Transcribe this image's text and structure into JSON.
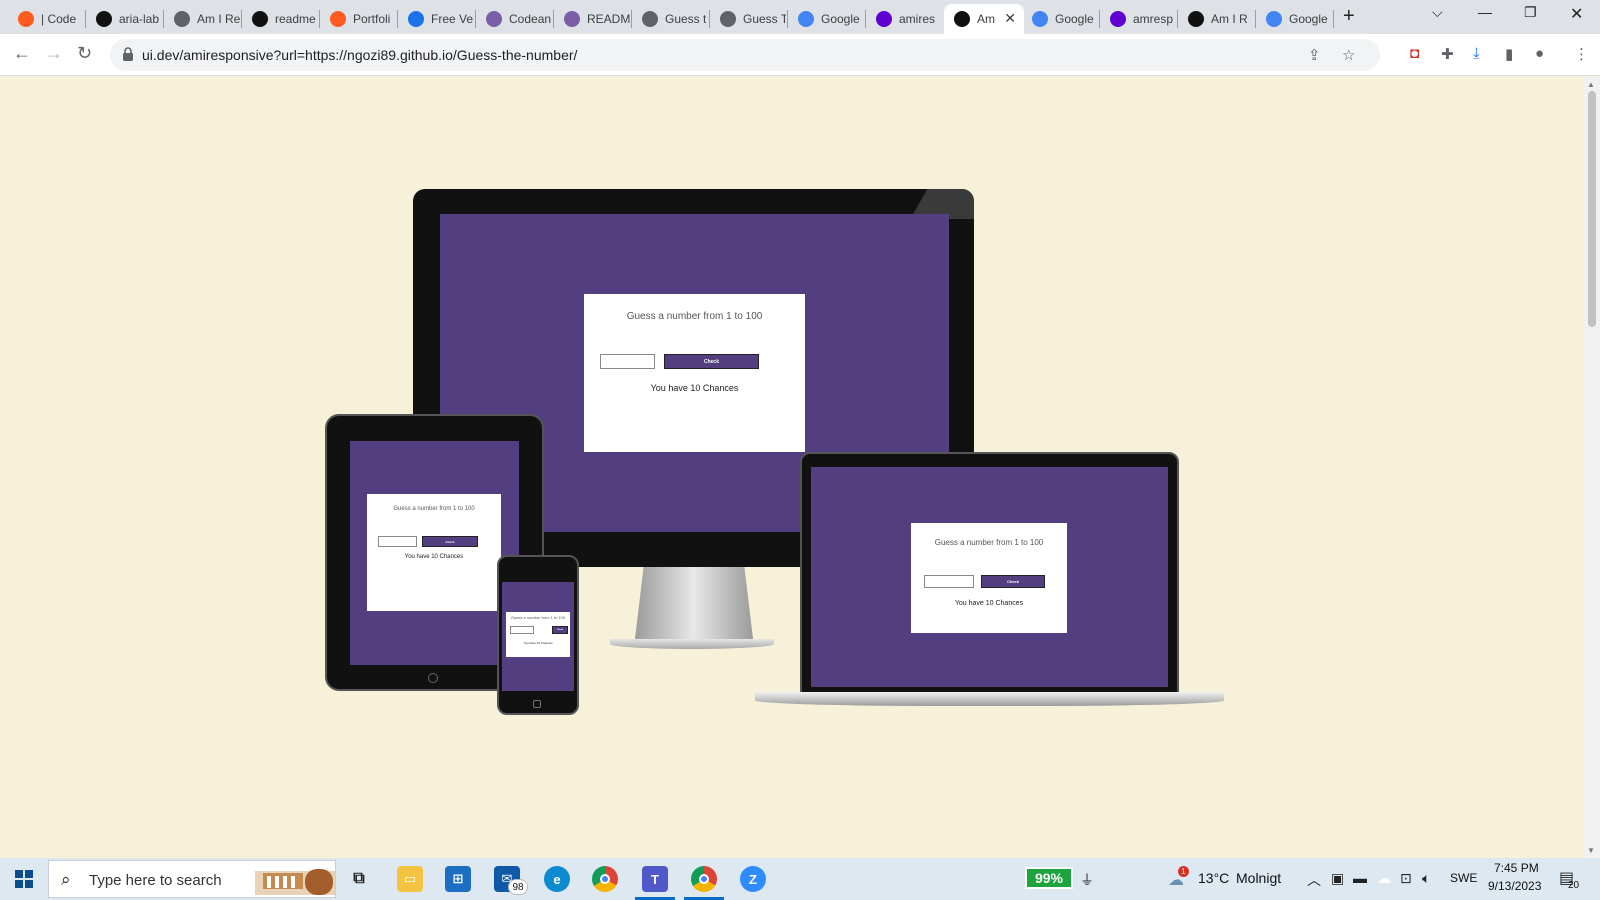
{
  "browser": {
    "tabs": [
      {
        "title": "| Code",
        "icon": "codepen-icon",
        "color": "#ff5a1f"
      },
      {
        "title": "aria-lab",
        "icon": "medium-icon",
        "color": "#111111"
      },
      {
        "title": "Am I Re",
        "icon": "globe-icon",
        "color": "#5f6368"
      },
      {
        "title": "readme",
        "icon": "github-icon",
        "color": "#111111"
      },
      {
        "title": "Portfoli",
        "icon": "codeanywhere-icon",
        "color": "#ff5a1f"
      },
      {
        "title": "Free Ve",
        "icon": "forms-icon",
        "color": "#1a73e8"
      },
      {
        "title": "Codean",
        "icon": "cube-icon",
        "color": "#7b5ea7"
      },
      {
        "title": "READM",
        "icon": "cube-icon",
        "color": "#7b5ea7"
      },
      {
        "title": "Guess t",
        "icon": "globe-icon",
        "color": "#5f6368"
      },
      {
        "title": "Guess T",
        "icon": "globe-icon",
        "color": "#5f6368"
      },
      {
        "title": "Google",
        "icon": "translate-icon",
        "color": "#4285f4"
      },
      {
        "title": "amires",
        "icon": "yahoo-icon",
        "color": "#6001d2"
      },
      {
        "title": "Am",
        "icon": "uidev-icon",
        "color": "#111111",
        "active": true
      },
      {
        "title": "Google",
        "icon": "translate-icon",
        "color": "#4285f4"
      },
      {
        "title": "amresp",
        "icon": "yahoo-icon",
        "color": "#6001d2"
      },
      {
        "title": "Am I R",
        "icon": "uidev-icon",
        "color": "#111111"
      },
      {
        "title": "Google",
        "icon": "translate-icon",
        "color": "#4285f4"
      }
    ],
    "url": "ui.dev/amiresponsive?url=https://ngozi89.github.io/Guess-the-number/"
  },
  "app": {
    "question": "Guess a number from 1 to 100",
    "check_label": "Check",
    "chances_text": "You have 10 Chances",
    "guess_input_value": "",
    "accent": "#533e80",
    "page_bg": "#f8f1da"
  },
  "taskbar": {
    "search_placeholder": "Type here to search",
    "mail_badge": "98",
    "battery": "99%",
    "weather_alert": "1",
    "temperature": "13°C",
    "weather": "Molnigt",
    "language": "SWE",
    "time": "7:45 PM",
    "date": "9/13/2023",
    "notifications": "20"
  }
}
